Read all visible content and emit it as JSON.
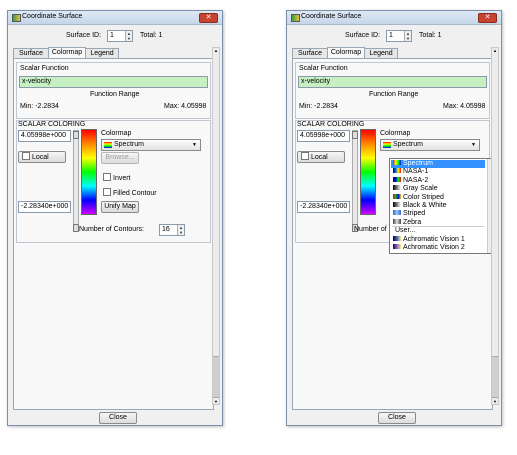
{
  "window": {
    "title": "Coordinate Surface",
    "close_glyph": "✕"
  },
  "top": {
    "surface_id_label": "Surface ID:",
    "surface_id_value": "1",
    "total_label": "Total: 1"
  },
  "tabs": [
    "Surface",
    "Colormap",
    "Legend"
  ],
  "scalar_function": {
    "header": "Scalar Function",
    "value": "x-velocity",
    "range_label": "Function Range",
    "min_label": "Min: -2.2834",
    "max_label": "Max: 4.05998"
  },
  "scalar_coloring": {
    "header": "SCALAR COLORING",
    "max_value": "4.05998e+000",
    "min_value": "-2.28340e+000",
    "local_label": "Local",
    "colormap_label": "Colormap",
    "colormap_selected": "Spectrum",
    "browse_label": "Browse...",
    "invert_label": "Invert",
    "filled_contour_label": "Filled Contour",
    "unify_map_label": "Unify Map",
    "contours_label": "Number of Contours:",
    "contours_label_truncated": "Number of C",
    "contours_value": "16"
  },
  "close_label": "Close",
  "colormap_options": [
    {
      "label": "Spectrum",
      "swatch": "linear-gradient(90deg,#ff0000,#ffff00,#00ff00,#0000ff)"
    },
    {
      "label": "NASA-1",
      "swatch": "linear-gradient(90deg,#000066,#0066ff,#ffff00,#ff0000)"
    },
    {
      "label": "NASA-2",
      "swatch": "linear-gradient(90deg,#330033,#0000ff,#00ff00,#ff0000)"
    },
    {
      "label": "Gray Scale",
      "swatch": "linear-gradient(90deg,#000000,#ffffff)"
    },
    {
      "label": "Color Striped",
      "swatch": "linear-gradient(90deg,#ff0000,#00cc00,#0000ff,#ffcc00)"
    },
    {
      "label": "Black & White",
      "swatch": "linear-gradient(90deg,#000000,#ffffff)"
    },
    {
      "label": "Striped",
      "swatch": "linear-gradient(90deg,#3366cc,#99ccff,#3366cc)"
    },
    {
      "label": "Zebra",
      "swatch": "linear-gradient(90deg,#444444,#dddddd,#444444)"
    },
    {
      "label": "User...",
      "swatch": ""
    },
    {
      "label": "Achromatic Vision 1",
      "swatch": "linear-gradient(90deg,#000044,#4466aa,#ffee88)"
    },
    {
      "label": "Achromatic Vision 2",
      "swatch": "linear-gradient(90deg,#220044,#8866cc,#ffee66)"
    }
  ],
  "colors": {
    "title_bar": "#c5d5e9",
    "scalar_field": "#c6f0c1",
    "selection": "#3390ff",
    "close_button": "#c8432f"
  }
}
